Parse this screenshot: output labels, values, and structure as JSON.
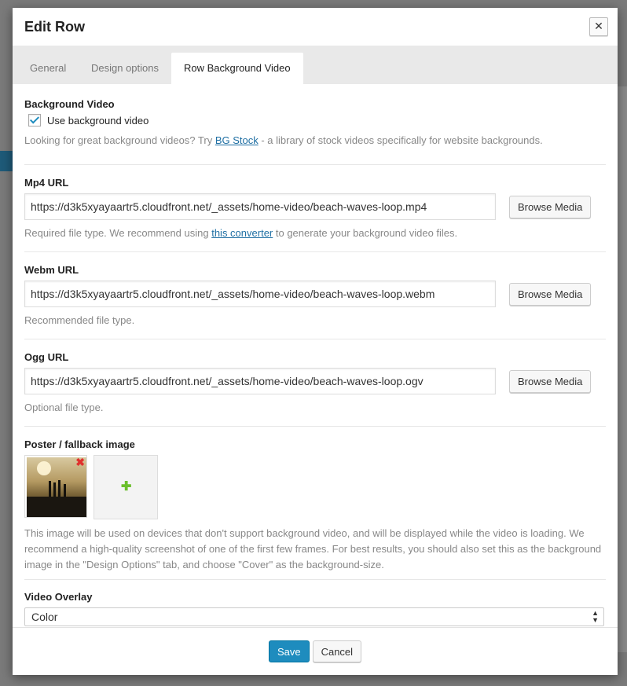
{
  "modal": {
    "title": "Edit Row",
    "close_icon": "close-icon",
    "tabs": [
      {
        "label": "General",
        "active": false
      },
      {
        "label": "Design options",
        "active": false
      },
      {
        "label": "Row Background Video",
        "active": true
      }
    ]
  },
  "background_video": {
    "label": "Background Video",
    "checkbox_label": "Use background video",
    "checked": true,
    "promo_prefix": "Looking for great background videos? Try ",
    "promo_link": "BG Stock",
    "promo_suffix": " - a library of stock videos specifically for website backgrounds."
  },
  "mp4": {
    "label": "Mp4 URL",
    "value": "https://d3k5xyayaartr5.cloudfront.net/_assets/home-video/beach-waves-loop.mp4",
    "button": "Browse Media",
    "desc_prefix": "Required file type. We recommend using ",
    "desc_link": "this converter",
    "desc_suffix": " to generate your background video files."
  },
  "webm": {
    "label": "Webm URL",
    "value": "https://d3k5xyayaartr5.cloudfront.net/_assets/home-video/beach-waves-loop.webm",
    "button": "Browse Media",
    "desc": "Recommended file type."
  },
  "ogg": {
    "label": "Ogg URL",
    "value": "https://d3k5xyayaartr5.cloudfront.net/_assets/home-video/beach-waves-loop.ogv",
    "button": "Browse Media",
    "desc": "Optional file type."
  },
  "poster": {
    "label": "Poster / fallback image",
    "remove_icon": "remove-icon",
    "add_icon": "plus-icon",
    "desc": "This image will be used on devices that don't support background video, and will be displayed while the video is loading. We recommend a high-quality screenshot of one of the first few frames. For best results, you should also set this as the background image in the \"Design Options\" tab, and choose \"Cover\" as the background-size."
  },
  "overlay": {
    "label": "Video Overlay",
    "selected": "Color"
  },
  "footer": {
    "save": "Save",
    "cancel": "Cancel"
  },
  "colors": {
    "primary": "#1e8cbe",
    "link": "#1f6fa3",
    "remove": "#e0302d",
    "add": "#6bbf2c"
  }
}
